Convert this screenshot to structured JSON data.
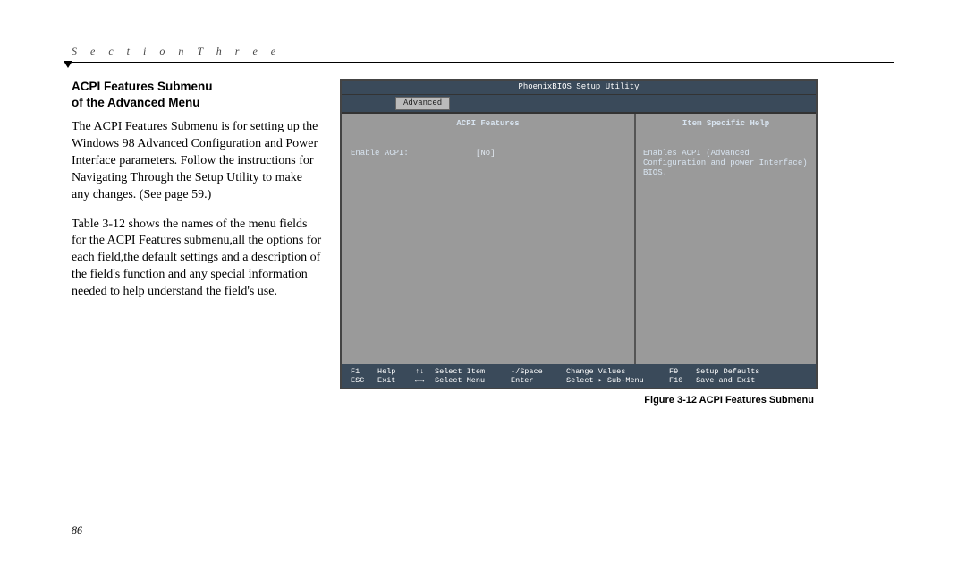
{
  "section_header": "S e c t i o n   T h r e e",
  "heading_line1": "ACPI Features Submenu",
  "heading_line2": "of the Advanced Menu",
  "paragraph1": "The ACPI Features Submenu is for setting up the Windows 98 Advanced Configuration and Power Interface parameters. Follow the instructions for Navigating Through the Setup Utility to make any changes. (See page 59.)",
  "paragraph2": "Table 3-12 shows the names of the menu fields for the ACPI Features submenu,all the options for each field,the default settings and a description of the field's function and any special information needed to help understand the field's use.",
  "bios": {
    "title": "PhoenixBIOS Setup Utility",
    "tab": "Advanced",
    "left_header": "ACPI Features",
    "right_header": "Item Specific Help",
    "field_label": "Enable ACPI:",
    "field_value": "[No]",
    "help_text": "Enables ACPI (Advanced Configuration and power Interface) BIOS.",
    "footer": {
      "r1": {
        "k1": "F1",
        "t1": "Help",
        "a1": "↑↓",
        "s1": "Select Item",
        "c1": "-/Space",
        "v1": "Change Values",
        "k2": "F9",
        "t2": "Setup Defaults"
      },
      "r2": {
        "k1": "ESC",
        "t1": "Exit",
        "a1": "←→",
        "s1": "Select Menu",
        "c1": "Enter",
        "v1": "Select ▸ Sub-Menu",
        "k2": "F10",
        "t2": "Save and Exit"
      }
    }
  },
  "figure_caption": "Figure 3-12 ACPI Features Submenu",
  "page_number": "86"
}
